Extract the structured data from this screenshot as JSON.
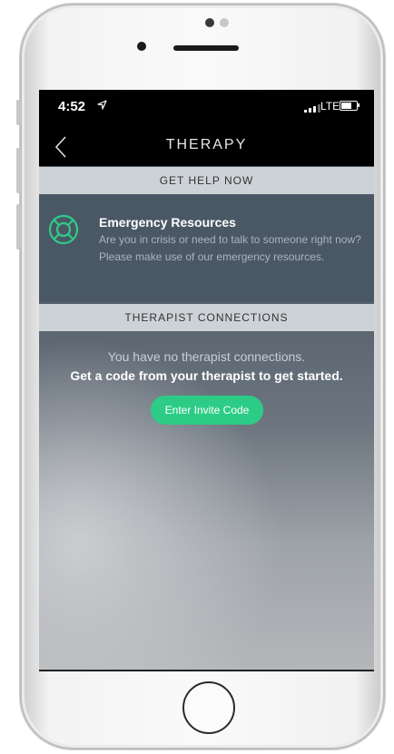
{
  "status_bar": {
    "time": "4:52",
    "location_icon": "location-arrow-icon",
    "network": "LTE",
    "signal_icon": "cellular-signal-icon",
    "battery_icon": "battery-icon"
  },
  "nav": {
    "title": "THERAPY",
    "back_icon": "chevron-left-icon"
  },
  "sections": {
    "get_help": "GET HELP NOW",
    "therapist_connections": "THERAPIST CONNECTIONS"
  },
  "emergency": {
    "icon": "lifebuoy-icon",
    "title": "Emergency Resources",
    "description": "Are you in crisis or need to talk to someone right now? Please make use of our emergency resources."
  },
  "connections": {
    "empty_message": "You have no therapist connections.",
    "instruction": "Get a code from your therapist to get started.",
    "button_label": "Enter Invite Code"
  },
  "colors": {
    "accent": "#2dcc86",
    "header_bg": "#000000",
    "section_header_bg": "#cdd2d7",
    "emergency_bg": "#4a5865"
  }
}
